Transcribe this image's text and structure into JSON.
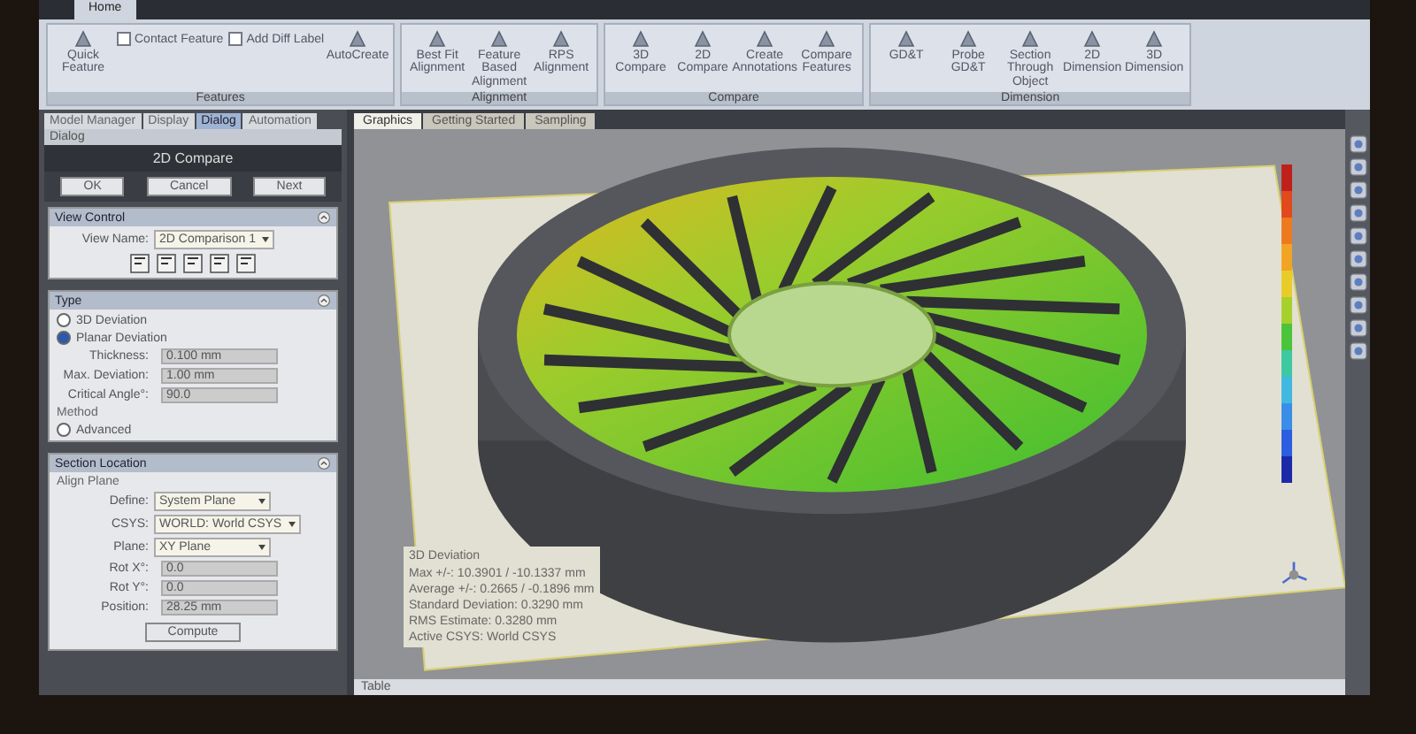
{
  "ribbon": {
    "tabs": [
      {
        "label": "Home",
        "selected": true
      }
    ],
    "groups": [
      {
        "label": "Features",
        "buttons": [
          {
            "label": "Quick Feature",
            "kind": "button"
          },
          {
            "label": "Contact Feature",
            "kind": "checkbox",
            "checked": false
          },
          {
            "label": "Add Diff Label",
            "kind": "checkbox",
            "checked": false
          },
          {
            "label": "AutoCreate",
            "kind": "button"
          }
        ]
      },
      {
        "label": "Alignment",
        "buttons": [
          {
            "label": "Best Fit Alignment",
            "kind": "button"
          },
          {
            "label": "Feature Based Alignment",
            "kind": "button"
          },
          {
            "label": "RPS Alignment",
            "kind": "button"
          }
        ]
      },
      {
        "label": "Compare",
        "buttons": [
          {
            "label": "3D Compare",
            "kind": "button"
          },
          {
            "label": "2D Compare",
            "kind": "button"
          },
          {
            "label": "Create Annotations",
            "kind": "button"
          },
          {
            "label": "Compare Features",
            "kind": "button"
          }
        ]
      },
      {
        "label": "Dimension",
        "buttons": [
          {
            "label": "GD&T",
            "kind": "button"
          },
          {
            "label": "Probe GD&T",
            "kind": "button"
          },
          {
            "label": "Section Through Object",
            "kind": "button"
          },
          {
            "label": "2D Dimension",
            "kind": "button"
          },
          {
            "label": "3D Dimension",
            "kind": "button"
          }
        ]
      }
    ]
  },
  "panel": {
    "tabs": [
      {
        "label": "Model Manager",
        "selected": false
      },
      {
        "label": "Display",
        "selected": false
      },
      {
        "label": "Dialog",
        "selected": true
      },
      {
        "label": "Automation",
        "selected": false
      }
    ],
    "header": "Dialog",
    "title": "2D Compare",
    "buttons": [
      "OK",
      "Cancel",
      "Next"
    ],
    "sections": [
      {
        "title": "View Control",
        "rows": [
          {
            "kind": "select",
            "label": "View Name:",
            "value": "2D Comparison 1"
          },
          {
            "kind": "icons"
          }
        ]
      },
      {
        "title": "Type",
        "rows": [
          {
            "kind": "radio",
            "label": "3D Deviation",
            "selected": false
          },
          {
            "kind": "radio",
            "label": "Planar Deviation",
            "selected": true
          },
          {
            "kind": "spin",
            "label": "Thickness:",
            "value": "0.100 mm"
          },
          {
            "kind": "spin",
            "label": "Max. Deviation:",
            "value": "1.00 mm"
          },
          {
            "kind": "spin",
            "label": "Critical Angle°:",
            "value": "90.0"
          },
          {
            "kind": "heading",
            "label": "Method"
          },
          {
            "kind": "radio",
            "label": "Advanced",
            "selected": false
          }
        ]
      },
      {
        "title": "Section Location",
        "rows": [
          {
            "kind": "heading",
            "label": "Align Plane"
          },
          {
            "kind": "select",
            "label": "Define:",
            "value": "System Plane"
          },
          {
            "kind": "select",
            "label": "CSYS:",
            "value": "WORLD: World CSYS"
          },
          {
            "kind": "select",
            "label": "Plane:",
            "value": "XY Plane"
          },
          {
            "kind": "spin",
            "label": "Rot X°:",
            "value": "0.0"
          },
          {
            "kind": "spin",
            "label": "Rot Y°:",
            "value": "0.0"
          },
          {
            "kind": "spin",
            "label": "Position:",
            "value": "28.25 mm"
          },
          {
            "kind": "button",
            "label": "Compute"
          }
        ]
      }
    ]
  },
  "view": {
    "tabs": [
      {
        "label": "Graphics",
        "selected": true
      },
      {
        "label": "Getting Started",
        "selected": false
      },
      {
        "label": "Sampling",
        "selected": false
      }
    ],
    "info": [
      "3D Deviation",
      "Max +/-: 10.3901 / -10.1337 mm",
      "Average +/-: 0.2665 / -0.1896 mm",
      "Standard Deviation: 0.3290 mm",
      "RMS Estimate: 0.3280 mm",
      "Active CSYS: World CSYS"
    ]
  },
  "bottom_bar": {
    "label": "Table"
  }
}
